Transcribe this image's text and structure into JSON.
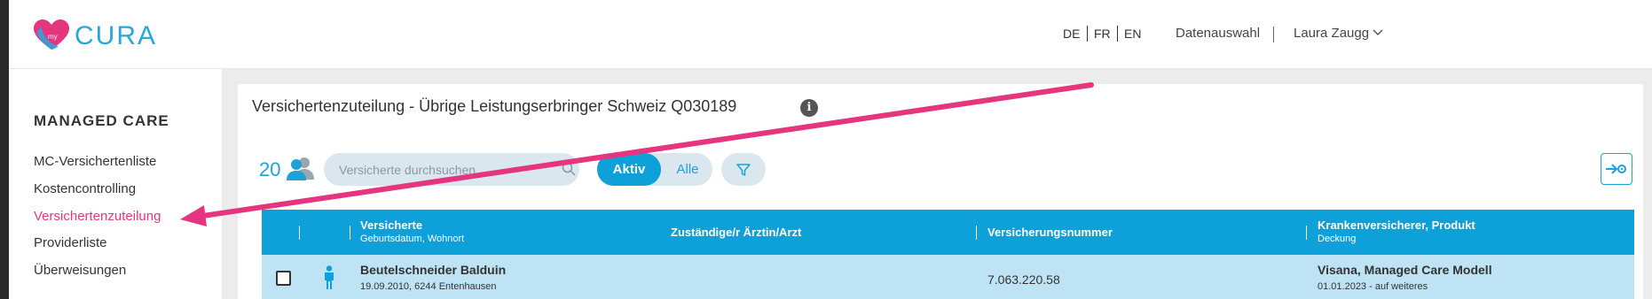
{
  "brand": {
    "logo_text": "CURA",
    "logo_sub": "my"
  },
  "header": {
    "languages": [
      "DE",
      "FR",
      "EN"
    ],
    "data_selection": "Datenauswahl",
    "user_name": "Laura Zaugg"
  },
  "sidebar": {
    "section_title": "MANAGED CARE",
    "items": [
      {
        "label": "MC-Versichertenliste"
      },
      {
        "label": "Kostencontrolling"
      },
      {
        "label": "Versichertenzuteilung",
        "active": true
      },
      {
        "label": "Providerliste"
      },
      {
        "label": "Überweisungen"
      }
    ]
  },
  "main": {
    "title": "Versichertenzuteilung - Übrige Leistungserbringer Schweiz Q030189",
    "count": "20",
    "search": {
      "placeholder": "Versicherte durchsuchen"
    },
    "toggle": {
      "active_label": "Aktiv",
      "all_label": "Alle"
    },
    "table": {
      "columns": [
        {
          "label": "Versicherte",
          "sub": "Geburtsdatum, Wohnort"
        },
        {
          "label": "Zuständige/r Ärztin/Arzt",
          "sub": ""
        },
        {
          "label": "Versicherungsnummer",
          "sub": ""
        },
        {
          "label": "Krankenversicherer, Produkt",
          "sub": "Deckung"
        }
      ],
      "rows": [
        {
          "name": "Beutelschneider Balduin",
          "birth_place": "19.09.2010, 6244 Entenhausen",
          "doctor": "",
          "insurance_number": "7.063.220.58",
          "insurer": "Visana, Managed Care Modell",
          "coverage": "01.01.2023 - auf weiteres"
        }
      ]
    }
  },
  "colors": {
    "accent": "#0ea0d8",
    "highlight": "#e6357f",
    "row_selected": "#bde3f4"
  }
}
